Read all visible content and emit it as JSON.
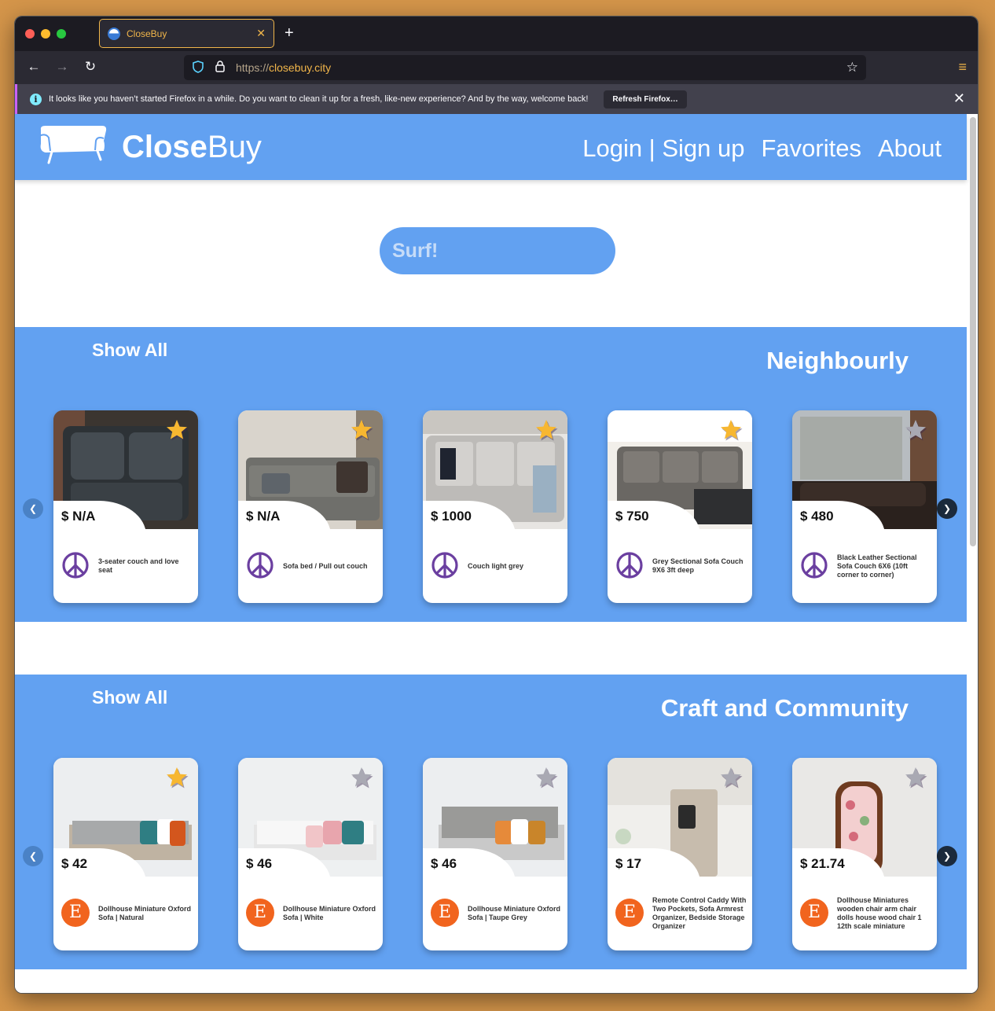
{
  "browser": {
    "tab_title": "CloseBuy",
    "url_scheme": "https://",
    "url_host": "closebuy.city",
    "notification_text": "It looks like you haven’t started Firefox in a while. Do you want to clean it up for a fresh, like-new experience? And by the way, welcome back!",
    "notification_button": "Refresh Firefox…"
  },
  "site": {
    "logo_bold": "Close",
    "logo_light": "Buy",
    "nav": {
      "login": "Login | Sign up",
      "favorites": "Favorites",
      "about": "About"
    },
    "search_placeholder": "Surf!"
  },
  "sections": [
    {
      "show_all": "Show All",
      "title": "Neighbourly",
      "cards": [
        {
          "price": "$ N/A",
          "name": "3-seater couch and love seat",
          "favorited": true,
          "source": "peace"
        },
        {
          "price": "$ N/A",
          "name": "Sofa bed / Pull out couch",
          "favorited": true,
          "source": "peace"
        },
        {
          "price": "$ 1000",
          "name": "Couch light grey",
          "favorited": true,
          "source": "peace"
        },
        {
          "price": "$ 750",
          "name": "Grey Sectional Sofa Couch 9X6 3ft deep",
          "favorited": true,
          "source": "peace"
        },
        {
          "price": "$ 480",
          "name": "Black Leather Sectional Sofa Couch 6X6 (10ft corner to corner)",
          "favorited": false,
          "source": "peace"
        }
      ]
    },
    {
      "show_all": "Show All",
      "title": "Craft and Community",
      "cards": [
        {
          "price": "$ 42",
          "name": "Dollhouse Miniature Oxford Sofa | Natural",
          "favorited": true,
          "source": "etsy"
        },
        {
          "price": "$ 46",
          "name": "Dollhouse Miniature Oxford Sofa | White",
          "favorited": false,
          "source": "etsy"
        },
        {
          "price": "$ 46",
          "name": "Dollhouse Miniature Oxford Sofa | Taupe Grey",
          "favorited": false,
          "source": "etsy"
        },
        {
          "price": "$ 17",
          "name": "Remote Control Caddy With Two Pockets,  Sofa Armrest Organizer, Bedside Storage Organizer",
          "favorited": false,
          "source": "etsy"
        },
        {
          "price": "$ 21.74",
          "name": "Dollhouse Miniatures wooden chair arm chair dolls house wood chair 1 12th scale miniature",
          "favorited": false,
          "source": "etsy"
        }
      ]
    }
  ],
  "colors": {
    "brand_blue": "#62a1f1",
    "star_active": "#f7b731",
    "star_inactive": "#a9a9b3",
    "peace_purple": "#6b3fa0",
    "etsy_orange": "#f1641e"
  },
  "icons": {
    "card_star": "star-icon",
    "neighbourly_source": "peace-sign-icon",
    "craft_source": "etsy-logo-icon"
  },
  "etsy_letter": "E"
}
